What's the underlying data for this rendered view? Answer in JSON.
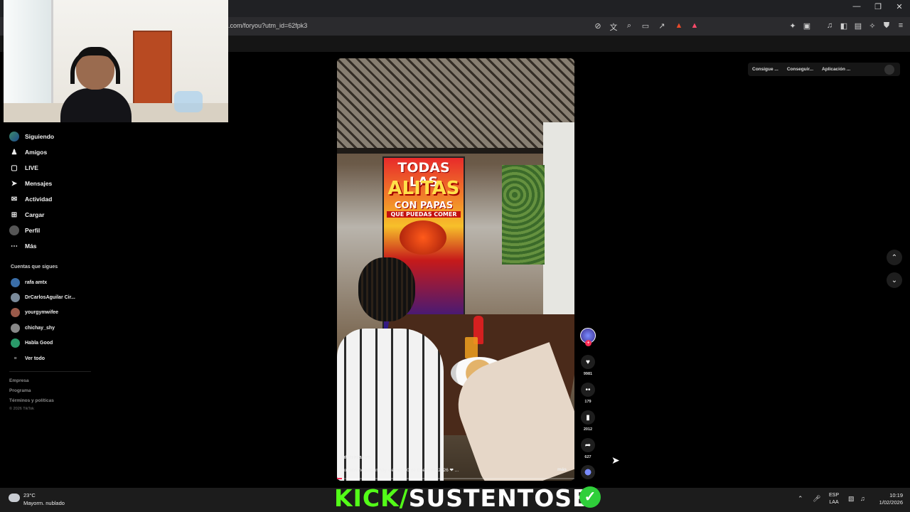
{
  "browser": {
    "url": ".com/foryou?utm_id=62fpk3",
    "window_controls": [
      "—",
      "❐",
      "✕"
    ],
    "left_tools": [
      "⊘",
      "文",
      "⌕",
      "▭",
      "↗"
    ],
    "right_tools": [
      "✦",
      "▣",
      "♫",
      "◧",
      "▤",
      "✧",
      "⛊",
      "≡"
    ]
  },
  "sidebar": {
    "items": [
      {
        "label": "Siguiendo",
        "icon": "following-avatar-icon"
      },
      {
        "label": "Amigos",
        "icon": "friends-icon"
      },
      {
        "label": "LIVE",
        "icon": "live-icon"
      },
      {
        "label": "Mensajes",
        "icon": "messages-icon"
      },
      {
        "label": "Actividad",
        "icon": "activity-icon"
      },
      {
        "label": "Cargar",
        "icon": "upload-icon"
      },
      {
        "label": "Perfil",
        "icon": "profile-avatar-icon"
      },
      {
        "label": "Más",
        "icon": "more-icon"
      }
    ],
    "following_title": "Cuentas que sigues",
    "following": [
      {
        "name": "rafa amtx",
        "color": "#3a6ea8"
      },
      {
        "name": "DrCarlosAguilar Cir...",
        "color": "#7a8a9a"
      },
      {
        "name": "yourgymwifee",
        "color": "#9a5a4a"
      },
      {
        "name": "chichay_shy",
        "color": "#888888"
      },
      {
        "name": "Habla Good",
        "color": "#2a9a6a"
      }
    ],
    "see_all": "Ver todo",
    "footer": [
      "Empresa",
      "Programa",
      "Términos y políticas"
    ],
    "copyright": "© 2026 TikTok"
  },
  "top_buttons": [
    "Consigue ...",
    "Conseguir...",
    "Aplicación ..."
  ],
  "video": {
    "poster_line1": "TODAS LAS",
    "poster_line2": "ALITAS",
    "poster_line3": "CON PAPAS",
    "poster_line4": "QUE PUEDAS COMER",
    "username": "laterrazahyo",
    "caption": "Los tíos no pagan hoy viernes 30 de Enero del 2026 ❤ ...",
    "more": "más",
    "progress": 0.02
  },
  "actions": {
    "likes": "9981",
    "comments": "179",
    "saves": "2012",
    "shares": "627"
  },
  "taskbar": {
    "temp": "23°C",
    "weather": "Mayorm. nublado",
    "overlay_prefix": "KICK/",
    "overlay_name": "SUSTENTOSB",
    "lang_line1": "ESP",
    "lang_line2": "LAA",
    "time": "10:19",
    "date": "1/02/2026"
  },
  "colors": {
    "accent": "#fe2c55",
    "kick_green": "#53fc18"
  }
}
